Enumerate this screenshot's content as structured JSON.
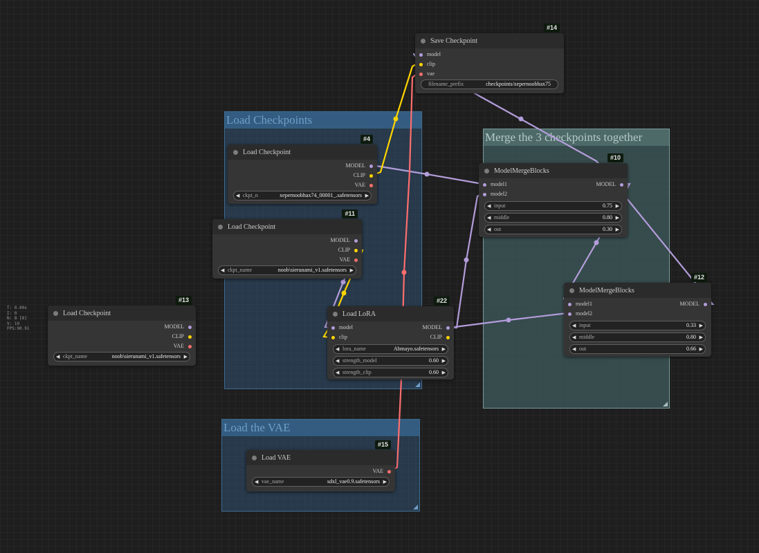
{
  "stats": [
    "T: 0.00s",
    "I: 0",
    "N: 8 [8]",
    "V: 19",
    "FPS:90.91"
  ],
  "groups": {
    "load_checkpoints": "Load Checkpoints",
    "merge": "Merge the 3 checkpoints together",
    "load_vae": "Load the VAE"
  },
  "colors": {
    "model": "#b39ddb",
    "clip": "#ffd500",
    "vae": "#ff6e6e",
    "group_blue": "#335c80",
    "group_teal": "#3f5b5c"
  },
  "nodes": {
    "n14": {
      "id": "#14",
      "title": "Save Checkpoint",
      "inputs": [
        "model",
        "clip",
        "vae"
      ],
      "filename_label": "filename_prefix",
      "filename_value": "checkpoints/xepernoobhax75"
    },
    "n4": {
      "id": "#4",
      "title": "Load Checkpoint",
      "outputs": [
        "MODEL",
        "CLIP",
        "VAE"
      ],
      "ckpt_label": "ckpt_n",
      "ckpt_value": "xepernoobhax74_00001_.safetensors"
    },
    "n11": {
      "id": "#11",
      "title": "Load Checkpoint",
      "outputs": [
        "MODEL",
        "CLIP",
        "VAE"
      ],
      "ckpt_label": "ckpt_name",
      "ckpt_value": "noob\\sierunami_v1.safetensors"
    },
    "n13": {
      "id": "#13",
      "title": "Load Checkpoint",
      "outputs": [
        "MODEL",
        "CLIP",
        "VAE"
      ],
      "ckpt_label": "ckpt_name",
      "ckpt_value": "noob\\sierunami_v1.safetensors"
    },
    "n22": {
      "id": "#22",
      "title": "Load LoRA",
      "inputs": [
        "model",
        "clip"
      ],
      "outputs": [
        "MODEL",
        "CLIP"
      ],
      "lora_label": "lora_name",
      "lora_value": "Abmayo.safetensors",
      "sm_label": "strength_model",
      "sm_value": "0.60",
      "sc_label": "strength_clip",
      "sc_value": "0.60"
    },
    "n10": {
      "id": "#10",
      "title": "ModelMergeBlocks",
      "inputs": [
        "model1",
        "model2"
      ],
      "output": "MODEL",
      "w1_label": "input",
      "w1_value": "0.75",
      "w2_label": "middle",
      "w2_value": "0.80",
      "w3_label": "out",
      "w3_value": "0.30"
    },
    "n12": {
      "id": "#12",
      "title": "ModelMergeBlocks",
      "inputs": [
        "model1",
        "model2"
      ],
      "output": "MODEL",
      "w1_label": "input",
      "w1_value": "0.33",
      "w2_label": "middle",
      "w2_value": "0.80",
      "w3_label": "out",
      "w3_value": "0.66"
    },
    "n15": {
      "id": "#15",
      "title": "Load VAE",
      "output": "VAE",
      "vae_label": "vae_name",
      "vae_value": "sdxl_vae0.9.safetensors"
    }
  }
}
